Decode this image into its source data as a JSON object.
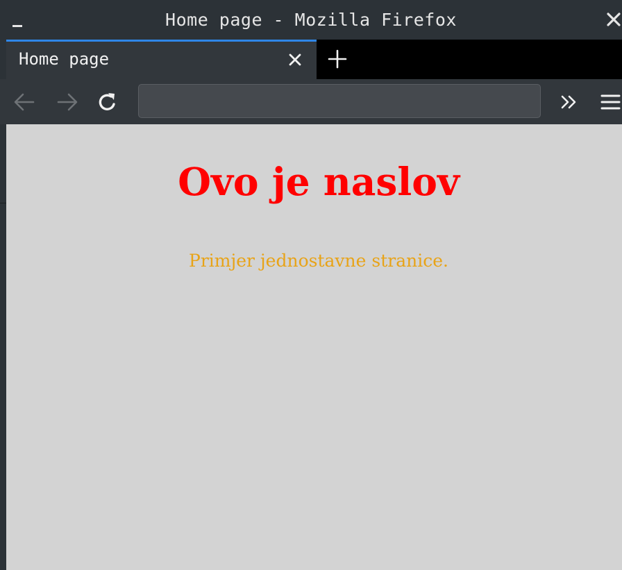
{
  "window": {
    "title": "Home page - Mozilla Firefox",
    "minimize_icon": "minimize-icon",
    "close_icon": "close-icon"
  },
  "tabs": [
    {
      "label": "Home page",
      "active": true
    }
  ],
  "toolbar": {
    "back_icon": "arrow-left-icon",
    "forward_icon": "arrow-right-icon",
    "reload_icon": "reload-icon",
    "url_value": "",
    "overflow_icon": "chevron-double-right-icon",
    "menu_icon": "hamburger-menu-icon"
  },
  "page": {
    "heading": "Ovo je naslov",
    "paragraph": "Primjer jednostavne stranice."
  },
  "colors": {
    "heading": "#ff0000",
    "paragraph": "#e8a317",
    "page_background": "#d3d3d3",
    "chrome_dark": "#32373c",
    "tab_accent": "#2f86e8"
  }
}
